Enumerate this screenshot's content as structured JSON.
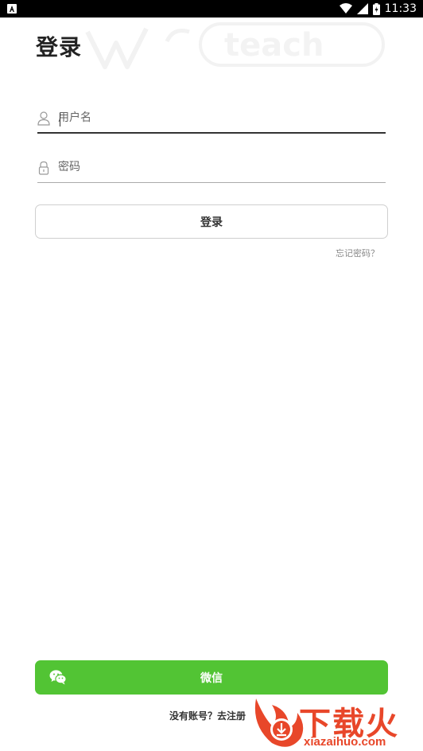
{
  "status_bar": {
    "time": "11:33",
    "icons": [
      "app-icon",
      "wifi-icon",
      "signal-icon",
      "battery-icon"
    ]
  },
  "watermark": {
    "text": "teach"
  },
  "header": {
    "title": "登录"
  },
  "form": {
    "username": {
      "placeholder": "用户名",
      "value": ""
    },
    "password": {
      "placeholder": "密码",
      "value": ""
    },
    "login_label": "登录",
    "forgot_label": "忘记密码？"
  },
  "footer": {
    "wechat_label": "微信",
    "register_text": "没有账号？去注册"
  },
  "brand_overlay": {
    "name": "下载火",
    "url": "xiazaihuo.com"
  },
  "colors": {
    "status_bar": "#000000",
    "wechat_green": "#52c434",
    "brand_orange": "#e8472a"
  }
}
